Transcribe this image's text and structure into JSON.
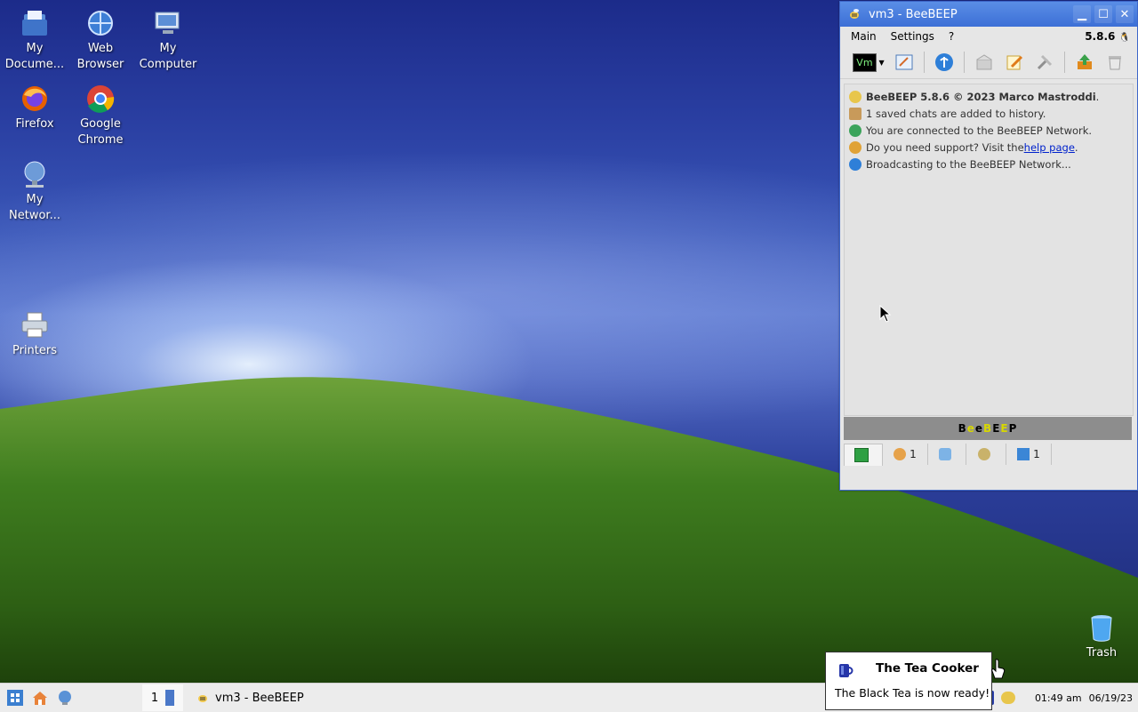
{
  "desktop": {
    "icons": [
      {
        "label": "My\nDocume...",
        "icon": "documents-folder-icon"
      },
      {
        "label": "Web\nBrowser",
        "icon": "web-browser-icon"
      },
      {
        "label": "My\nComputer",
        "icon": "computer-icon"
      },
      {
        "label": "Firefox",
        "icon": "firefox-icon"
      },
      {
        "label": "Google\nChrome",
        "icon": "chrome-icon"
      },
      {
        "label": "My\nNetwor...",
        "icon": "network-icon"
      },
      {
        "label": "Printers",
        "icon": "printer-icon"
      },
      {
        "label": "Trash",
        "icon": "trash-icon"
      }
    ]
  },
  "window": {
    "title": "vm3 - BeeBEEP",
    "menu": [
      "Main",
      "Settings",
      "?"
    ],
    "version": "5.8.6",
    "toolbar": {
      "status_badge": "Vm",
      "icons": [
        "status-selector-icon",
        "edit-profile-icon",
        "network-icon",
        "send-file-icon",
        "notes-icon",
        "tools-icon",
        "update-icon",
        "trash-chat-icon"
      ]
    },
    "log": {
      "line1": "BeeBEEP 5.8.6 © 2023 Marco Mastroddi",
      "line1_end": ".",
      "line2": "1 saved chats are added to history.",
      "line3": "You are connected to the BeeBEEP Network.",
      "line4_prefix": "Do you need support? Visit the ",
      "line4_link": "help page",
      "line4_suffix": ".",
      "line5": "Broadcasting to the BeeBEEP Network..."
    },
    "namebar": [
      "B",
      "e",
      "e",
      "B",
      "E",
      "E",
      "P"
    ],
    "tabs": [
      {
        "icon": "home-tab-icon",
        "count": ""
      },
      {
        "icon": "users-tab-icon",
        "count": "1"
      },
      {
        "icon": "chats-tab-icon",
        "count": ""
      },
      {
        "icon": "groups-tab-icon",
        "count": ""
      },
      {
        "icon": "files-tab-icon",
        "count": "1"
      }
    ]
  },
  "taskbar": {
    "workspace": "1",
    "task_title": "vm3 - BeeBEEP",
    "time": "01:49 am",
    "date": "06/19/23"
  },
  "notification": {
    "title": "The Tea Cooker",
    "body": "The Black Tea is now ready!"
  },
  "colors": {
    "titlebar": "#3c6fd6",
    "namebar": "#8d8d8d",
    "link": "#0022cc",
    "namebar_yellow": "#d7d700"
  }
}
